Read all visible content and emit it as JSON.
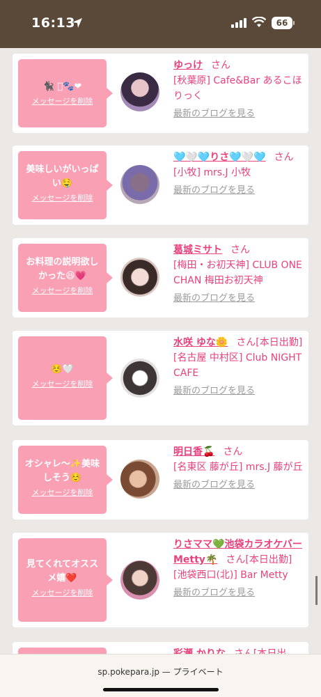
{
  "status": {
    "time": "16:13",
    "battery": "66"
  },
  "cards": [
    {
      "message": "🐈‍⬛ ﾟ🐾❤",
      "delete_label": "メッセージを削除",
      "name": "ゆっけ",
      "suffix": "さん",
      "shop": "[秋葉原] Cafe&Bar あるこほりっく",
      "blog": "最新のブログを見る"
    },
    {
      "message": "美味しいがいっぱい🤤",
      "delete_label": "メッセージを削除",
      "name": "🩵🤍🩵りさ🩵🤍🩵",
      "suffix": "さん",
      "shop": "[小牧] mrs.J 小牧",
      "blog": "最新のブログを見る"
    },
    {
      "message": "お料理の説明欲しかった😆💗",
      "delete_label": "メッセージを削除",
      "name": "葛城ミサト",
      "suffix": "さん",
      "shop": "[梅田・お初天神] CLUB ONE CHAN 梅田お初天神",
      "blog": "最新のブログを見る"
    },
    {
      "message": "☺️🤍",
      "delete_label": "メッセージを削除",
      "name": "水咲 ゆな🌼",
      "suffix": "さん[本日出勤]",
      "shop": "[名古屋 中村区] Club NIGHT CAFE",
      "blog": "最新のブログを見る"
    },
    {
      "message": "オシャレ〜✨美味しそう☺️",
      "delete_label": "メッセージを削除",
      "name": "明日香🍒",
      "suffix": "さん",
      "shop": "[名東区 藤が丘] mrs.J 藤が丘",
      "blog": "最新のブログを見る"
    },
    {
      "message": "見てくれてオススメ嬉❤️",
      "delete_label": "メッセージを削除",
      "name": "りさママ💚池袋カラオケバーMetty🌴",
      "suffix": "さん[本日出勤]",
      "shop": "[池袋西口(北)] Bar Metty",
      "blog": "最新のブログを見る"
    },
    {
      "message": "",
      "delete_label": "",
      "name": "彩瀬 かりな",
      "suffix": "さん[本日出",
      "shop": "",
      "blog": ""
    }
  ],
  "browser": {
    "url": "sp.pokepara.jp — プライベート"
  }
}
